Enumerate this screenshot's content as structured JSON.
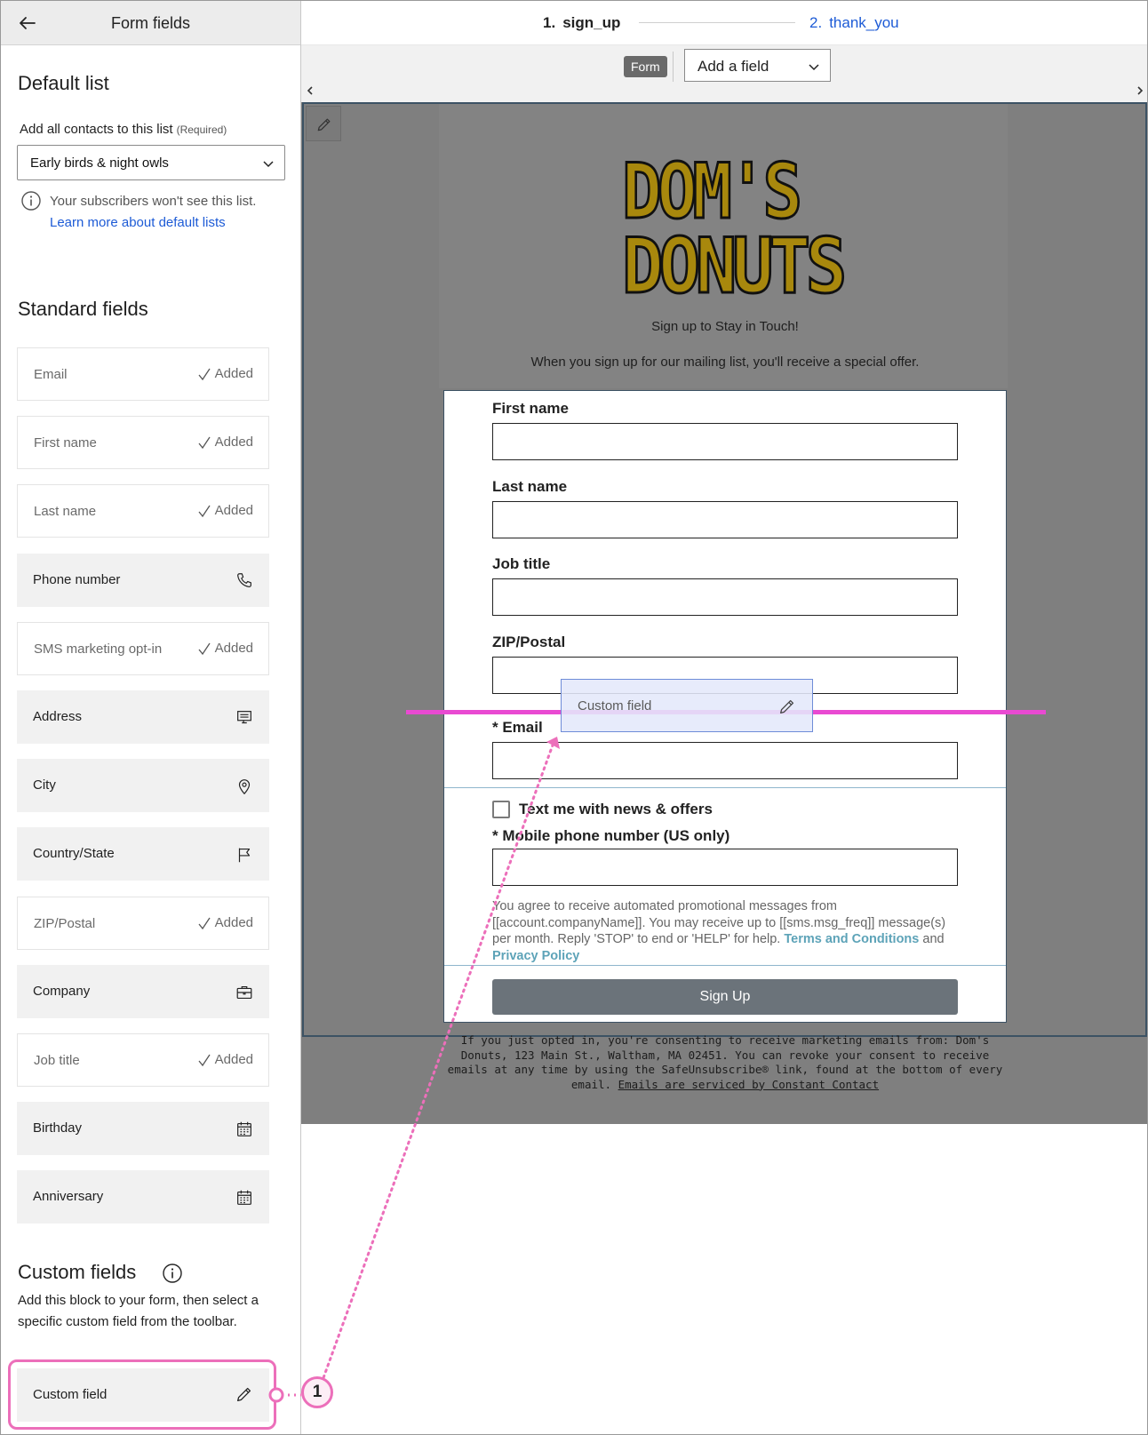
{
  "sidebar": {
    "title": "Form fields",
    "default_list": {
      "title": "Default list",
      "label": "Add all contacts to this list",
      "required": "(Required)",
      "selected": "Early birds & night owls",
      "note": "Your subscribers won't see this list.",
      "link": "Learn more about default lists"
    },
    "standard": {
      "title": "Standard fields",
      "items": [
        {
          "label": "Email",
          "status": "Added"
        },
        {
          "label": "First name",
          "status": "Added"
        },
        {
          "label": "Last name",
          "status": "Added"
        },
        {
          "label": "Phone number",
          "icon": "phone-icon"
        },
        {
          "label": "SMS marketing opt-in",
          "status": "Added"
        },
        {
          "label": "Address",
          "icon": "address-icon"
        },
        {
          "label": "City",
          "icon": "location-pin-icon"
        },
        {
          "label": "Country/State",
          "icon": "flag-icon"
        },
        {
          "label": "ZIP/Postal",
          "status": "Added"
        },
        {
          "label": "Company",
          "icon": "briefcase-icon"
        },
        {
          "label": "Job title",
          "status": "Added"
        },
        {
          "label": "Birthday",
          "icon": "calendar-icon"
        },
        {
          "label": "Anniversary",
          "icon": "calendar-icon"
        }
      ]
    },
    "custom": {
      "title": "Custom fields",
      "description": "Add this block to your form, then select a specific custom field from the toolbar.",
      "item_label": "Custom field"
    }
  },
  "steps": [
    {
      "num": "1.",
      "name": "sign_up"
    },
    {
      "num": "2.",
      "name": "thank_you"
    }
  ],
  "toolbar": {
    "badge": "Form",
    "add_field": "Add a field"
  },
  "logo": {
    "line1": "DOM'S",
    "line2": "DONUTS",
    "colors": {
      "outline": "#111111",
      "fill": "#a8880d"
    }
  },
  "form": {
    "tagline": "Sign up to Stay in Touch!",
    "subtitle": "When you sign up for our mailing list, you'll receive a special offer.",
    "fields": [
      "First name",
      "Last name",
      "Job title",
      "ZIP/Postal"
    ],
    "email_label": "* Email",
    "sms_checkbox": "Text me with news & offers",
    "mobile_label": "* Mobile phone number (US only)",
    "consent": "You agree to receive automated promotional messages from [[account.companyName]]. You may receive up to [[sms.msg_freq]] message(s) per month. Reply 'STOP' to end or 'HELP' for help.",
    "terms_link": "Terms and Conditions",
    "and": "and",
    "privacy_link": "Privacy Policy",
    "submit": "Sign Up"
  },
  "disclaimer": {
    "text": "If you just opted in, you're consenting to receive marketing emails from: Dom's Donuts, 123 Main St., Waltham, MA 02451. You can revoke your consent to receive emails at any time by using the SafeUnsubscribe® link, found at the bottom of every email.",
    "link": "Emails are serviced by Constant Contact"
  },
  "drag_ghost": {
    "label": "Custom field"
  },
  "callout": {
    "number": "1"
  },
  "colors": {
    "accent": "#1d5bd6",
    "highlight": "#ec6fba",
    "drop_line": "#e94ad2",
    "link_teal": "#5da3b8"
  }
}
